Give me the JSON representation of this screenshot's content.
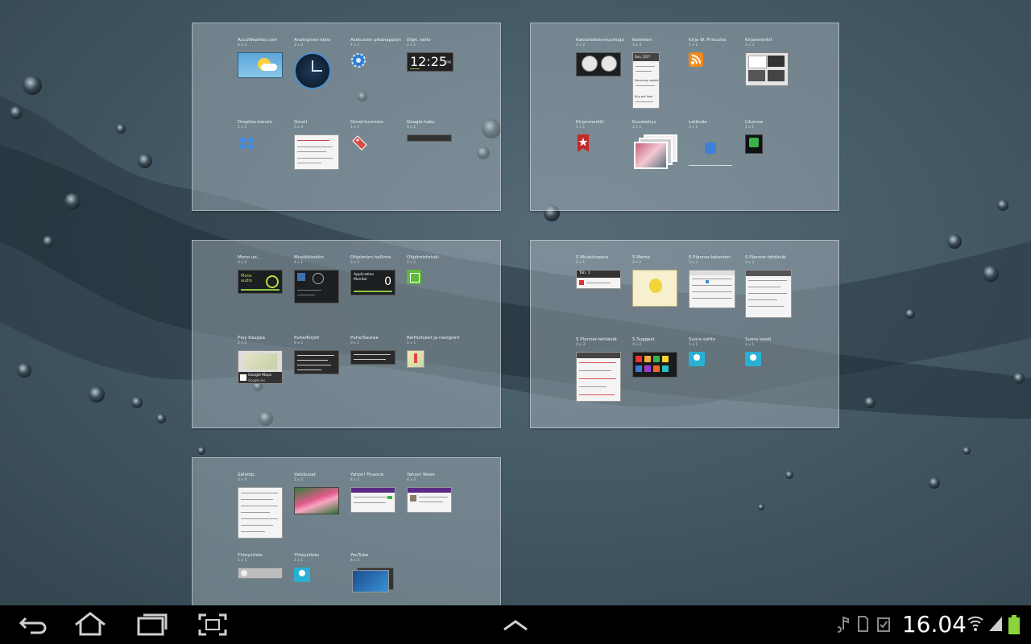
{
  "panels": [
    {
      "widgets": [
        {
          "name": "AccuWeather.com",
          "size": "4 x 2"
        },
        {
          "name": "Analoginen kello",
          "size": "2 x 2"
        },
        {
          "name": "Asetusten pikanappain",
          "size": "1 x 1"
        },
        {
          "name": "Digit. kello",
          "size": "2 x 1",
          "time": "12:25",
          "ampm": "PM"
        },
        {
          "name": "Dropbox-kansio",
          "size": "1 x 1"
        },
        {
          "name": "Gmail",
          "size": "3 x 3"
        },
        {
          "name": "Gmail-tunniste",
          "size": "1 x 1"
        },
        {
          "name": "Google-haku",
          "size": "4 x 1"
        }
      ]
    },
    {
      "widgets": [
        {
          "name": "Kaksoiskellomuuntaja",
          "size": "4 x 2"
        },
        {
          "name": "Kalenteri",
          "size": "3 x 3",
          "preview_lines": [
            "Sun, 5/27",
            "Samsung update",
            "Buy pet food"
          ]
        },
        {
          "name": "Kirja W. Pl-kuulta",
          "size": "1 x 1"
        },
        {
          "name": "Kirjanmerkit",
          "size": "3 x 3"
        },
        {
          "name": "Kirjanmerkki",
          "size": "1 x 1"
        },
        {
          "name": "Kuvakehys",
          "size": "2 x 2"
        },
        {
          "name": "Latitude",
          "size": "3 x 1"
        },
        {
          "name": "Lilcense",
          "size": "1 x 1"
        }
      ]
    },
    {
      "widgets": [
        {
          "name": "Mono ud...",
          "size": "3 x 2",
          "preview_text": "Mono audio"
        },
        {
          "name": "Musiikkisoitin",
          "size": "4 x 1"
        },
        {
          "name": "Ohjelmien hallinta",
          "size": "2 x 2",
          "preview_text": "Application Monitor",
          "count": "0"
        },
        {
          "name": "Ohjelmistotuki",
          "size": "1 x 1"
        },
        {
          "name": "Play Kauppa",
          "size": "2 x 2",
          "preview_text": "Google Maps",
          "preview_sub": "Google Inc."
        },
        {
          "name": "Puhe/Kirjoit",
          "size": "4 x 2"
        },
        {
          "name": "Puhe/Seuraa",
          "size": "3 x 1"
        },
        {
          "name": "Reittiohjeet ja navigointi",
          "size": "1 x 1"
        }
      ]
    },
    {
      "widgets": [
        {
          "name": "S Muistiinpano",
          "size": "2 x 1",
          "preview_text": "Täh. 1"
        },
        {
          "name": "S Memo",
          "size": "2 x 2"
        },
        {
          "name": "S Planner-kalenteri",
          "size": "3 x 3"
        },
        {
          "name": "S Planner-tehtävät",
          "size": "4 x 3"
        },
        {
          "name": "S Planner-tehtävät",
          "size": "4 x 3"
        },
        {
          "name": "S Suggest",
          "size": "4 x 2"
        },
        {
          "name": "Suora soitto",
          "size": "1 x 1"
        },
        {
          "name": "Suora viesti",
          "size": "1 x 1"
        }
      ]
    },
    {
      "widgets": [
        {
          "name": "Sähköp.",
          "size": "4 x 4"
        },
        {
          "name": "Valokuvat",
          "size": "2 x 2"
        },
        {
          "name": "Yahoo! Finance",
          "size": "4 x 2"
        },
        {
          "name": "Yahoo! News",
          "size": "4 x 2"
        },
        {
          "name": "Yhteystieto",
          "size": "1 x 1"
        },
        {
          "name": "Yhteystieto",
          "size": "1 x 1"
        },
        {
          "name": "YouTube",
          "size": "4 x 2"
        }
      ]
    }
  ],
  "status": {
    "time": "16.04",
    "battery": "75%"
  },
  "nav": {
    "back": "back-icon",
    "home": "home-icon",
    "recent": "recent-apps-icon",
    "screenshot": "screenshot-icon",
    "up": "chevron-up-icon"
  },
  "colors": {
    "navbar": "#000000",
    "panel": "#b6c2c8",
    "battery": "#8ad43a"
  }
}
